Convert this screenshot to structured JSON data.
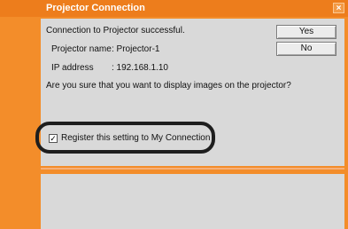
{
  "window": {
    "title": "Projector Connection",
    "close_glyph": "×",
    "accent_color": "#ed7d1c"
  },
  "dialog": {
    "status_text": "Connection to Projector successful.",
    "projector_name_label": "Projector name",
    "projector_name_value": ":  Projector-1",
    "ip_label": "IP address",
    "ip_value": ":  192.168.1.10",
    "question": "Are you sure that you want to display images on the projector?",
    "yes_label": "Yes",
    "no_label": "No",
    "checkbox_label": "Register this setting to My Connection",
    "checkbox_checked": true,
    "checkbox_glyph": "✓"
  }
}
